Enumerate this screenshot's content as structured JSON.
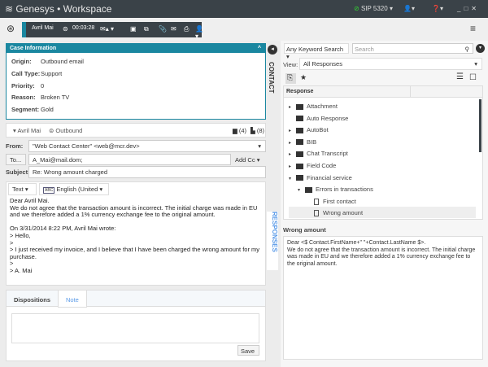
{
  "app": {
    "brand": "Genesys",
    "separator": "•",
    "title": "Workspace",
    "sip": "SIP 5320"
  },
  "interaction": {
    "name": "Avril Mai",
    "timer": "00:03:28"
  },
  "case": {
    "title": "Case Information",
    "fields": [
      {
        "label": "Origin:",
        "value": "Outbound email"
      },
      {
        "label": "Call Type:",
        "value": "Support"
      },
      {
        "label": "Priority:",
        "value": "0"
      },
      {
        "label": "Reason:",
        "value": "Broken TV"
      },
      {
        "label": "Segment:",
        "value": "Gold"
      }
    ]
  },
  "contact_tab": "CONTACT",
  "responses_tab": "RESPONSES",
  "party": {
    "name": "Avril Mai",
    "direction": "Outbound",
    "cases": "(4)",
    "history": "(8)"
  },
  "email": {
    "from_label": "From:",
    "from": "\"Web Contact Center\" <web@mcr.dev>",
    "to_button": "To...",
    "to": "A_Mai@mail.dom;",
    "add_cc": "Add Cc",
    "subject_label": "Subject:",
    "subject": "Re: Wrong amount charged",
    "format": "Text",
    "language": "English (United",
    "body": [
      "Dear Avril Mai.",
      "We do not agree that the transaction amount is incorrect. The initial charge was made in EU and we therefore added a 1% currency exchange fee to the original amount.",
      "",
      "On 3/31/2014 8:22 PM, Avril Mai wrote:",
      "> Hello,",
      ">",
      "> I just received my invoice, and I believe that I have been charged the wrong amount for my purchase.",
      ">",
      "> A. Mai"
    ]
  },
  "notes": {
    "tabs": [
      "Dispositions",
      "Note"
    ],
    "active": "Note",
    "save": "Save"
  },
  "responses": {
    "search_type": "Any Keyword Search",
    "search_placeholder": "Search",
    "view_label": "View:",
    "view": "All Responses",
    "column": "Response",
    "tree": [
      {
        "label": "Attachment",
        "type": "folder",
        "level": 0,
        "expander": "right"
      },
      {
        "label": "Auto Response",
        "type": "folder",
        "level": 0,
        "expander": ""
      },
      {
        "label": "AutoBot",
        "type": "folder",
        "level": 0,
        "expander": "right"
      },
      {
        "label": "BIB",
        "type": "folder",
        "level": 0,
        "expander": "right"
      },
      {
        "label": "Chat Transcript",
        "type": "folder",
        "level": 0,
        "expander": "right"
      },
      {
        "label": "Field Code",
        "type": "folder",
        "level": 0,
        "expander": "right"
      },
      {
        "label": "Financial service",
        "type": "folder",
        "level": 0,
        "expander": "down"
      },
      {
        "label": "Errors in transactions",
        "type": "folder",
        "level": 1,
        "expander": "down"
      },
      {
        "label": "First contact",
        "type": "doc",
        "level": 2,
        "expander": ""
      },
      {
        "label": "Wrong amount",
        "type": "doc",
        "level": 2,
        "expander": "",
        "selected": true
      }
    ],
    "preview_title": "Wrong amount",
    "preview": "Dear <$ Contact.FirstName+\" \"+Contact.LastName $>.\nWe do not agree that the transaction amount is incorrect. The initial charge was made in EU and we therefore added a 1% currency exchange fee to the original amount."
  }
}
